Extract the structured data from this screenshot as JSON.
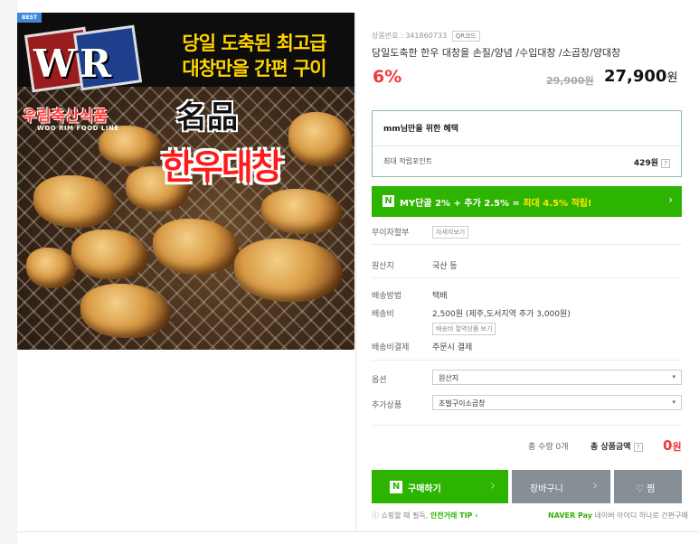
{
  "image": {
    "badge": "BEST",
    "logo_text": "WR",
    "headline_line1": "당일 도축된 최고급",
    "headline_line2": "대창만을 간편 구이",
    "brand_kr": "우림축산식품",
    "brand_en": "WOO RIM FOOD LINE",
    "hanja": "名品",
    "big_name": "한우대창"
  },
  "product": {
    "number_label": "상품번호 : 341860733",
    "qr_label": "QR코드",
    "title": "당일도축한 한우 대창을 손질/양념 /수입대창 /소곱창/양대창",
    "discount": "6%",
    "original_price": "29,900원",
    "sale_price": "27,900",
    "sale_unit": "원"
  },
  "benefit": {
    "title": "mm님만을 위한 혜택",
    "point_label": "최대 적립포인트",
    "point_value": "429원",
    "help": "?"
  },
  "my_band": {
    "n_logo": "N",
    "text_prefix": "MY단골 2% + 추가 2.5% = ",
    "text_highlight": "최대 4.5% 적립!",
    "arrow": "›"
  },
  "info": {
    "installment_label": "무이자할부",
    "installment_btn": "자세히보기",
    "origin_label": "원산지",
    "origin_value": "국산 등",
    "shipping_method_label": "배송방법",
    "shipping_method_value": "택배",
    "shipping_fee_label": "배송비",
    "shipping_fee_value": "2,500원 (제주,도서지역 추가 3,000원)",
    "free_ship_btn": "배송비 절약상품 보기",
    "payment_label": "배송비결제",
    "payment_value": "주문시 결제"
  },
  "options": {
    "option_label": "옵션",
    "option_selected": "원산지",
    "addon_label": "추가상품",
    "addon_selected": "초벌구이소곱창",
    "caret": "▾"
  },
  "totals": {
    "qty_text": "총 수량 0개",
    "amount_label": "총 상품금액",
    "help": "?",
    "amount_value": "0",
    "amount_unit": "원"
  },
  "buttons": {
    "buy_n": "N",
    "buy": "구매하기",
    "cart": "장바구니",
    "wish": "♡ 찜",
    "chevron": "›"
  },
  "footer": {
    "info_icon": "ⓘ",
    "safe_prefix": "쇼핑할 때 필독, ",
    "safe_highlight": "안전거래 TIP ›",
    "naver_pay": "NAVER Pay",
    "naver_pay_desc": "네이버 아이디 하나로 간편구매"
  }
}
